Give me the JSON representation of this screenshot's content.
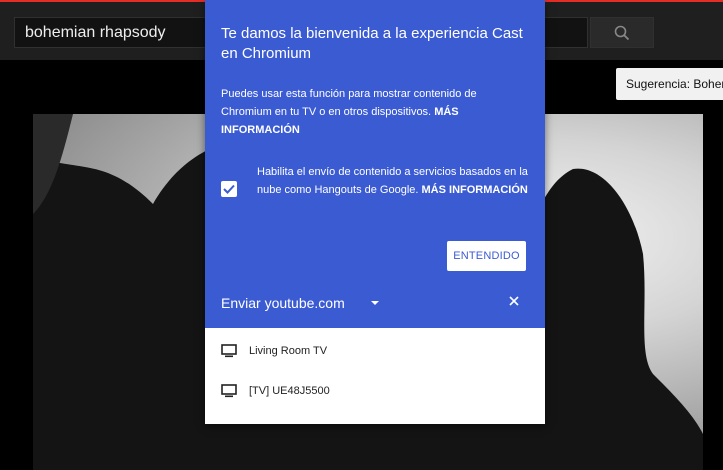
{
  "search": {
    "value": "bohemian rhapsody"
  },
  "suggestion": {
    "text": "Sugerencia: Bohemian Rhapsody"
  },
  "cast_dialog": {
    "title": "Te damos la bienvenida a la experiencia Cast en Chromium",
    "description": "Puedes usar esta función para mostrar contenido de Chromium en tu TV o en otros dispositivos.",
    "description_link": "MÁS INFORMACIÓN",
    "checkbox": {
      "checked": true,
      "text": "Habilita el envío de contenido a servicios basados en la nube como Hangouts de Google.",
      "link": "MÁS INFORMACIÓN"
    },
    "ok_button": "ENTENDIDO",
    "source_label": "Enviar youtube.com",
    "devices": [
      {
        "name": "Living Room TV",
        "icon": "tv-icon"
      },
      {
        "name": "[TV] UE48J5500",
        "icon": "tv-icon"
      }
    ]
  },
  "colors": {
    "header_blue": "#3b5bd3",
    "topbar_red": "#e52d27",
    "masthead": "#1f1f1f"
  }
}
